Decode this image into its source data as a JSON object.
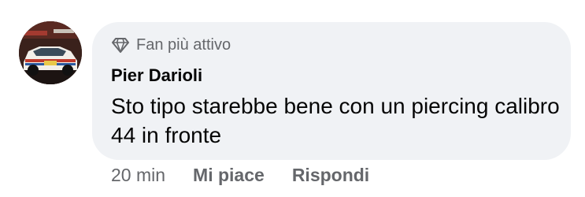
{
  "comment": {
    "badge": {
      "icon": "diamond-icon",
      "label": "Fan più attivo"
    },
    "author": "Pier Darioli",
    "text": "Sto tipo starebbe bene con un piercing calibro 44 in fronte",
    "time": "20 min",
    "actions": {
      "like": "Mi piace",
      "reply": "Rispondi"
    }
  },
  "colors": {
    "bubble_bg": "#f0f2f5",
    "secondary_text": "#65676b",
    "primary_text": "#050505"
  }
}
